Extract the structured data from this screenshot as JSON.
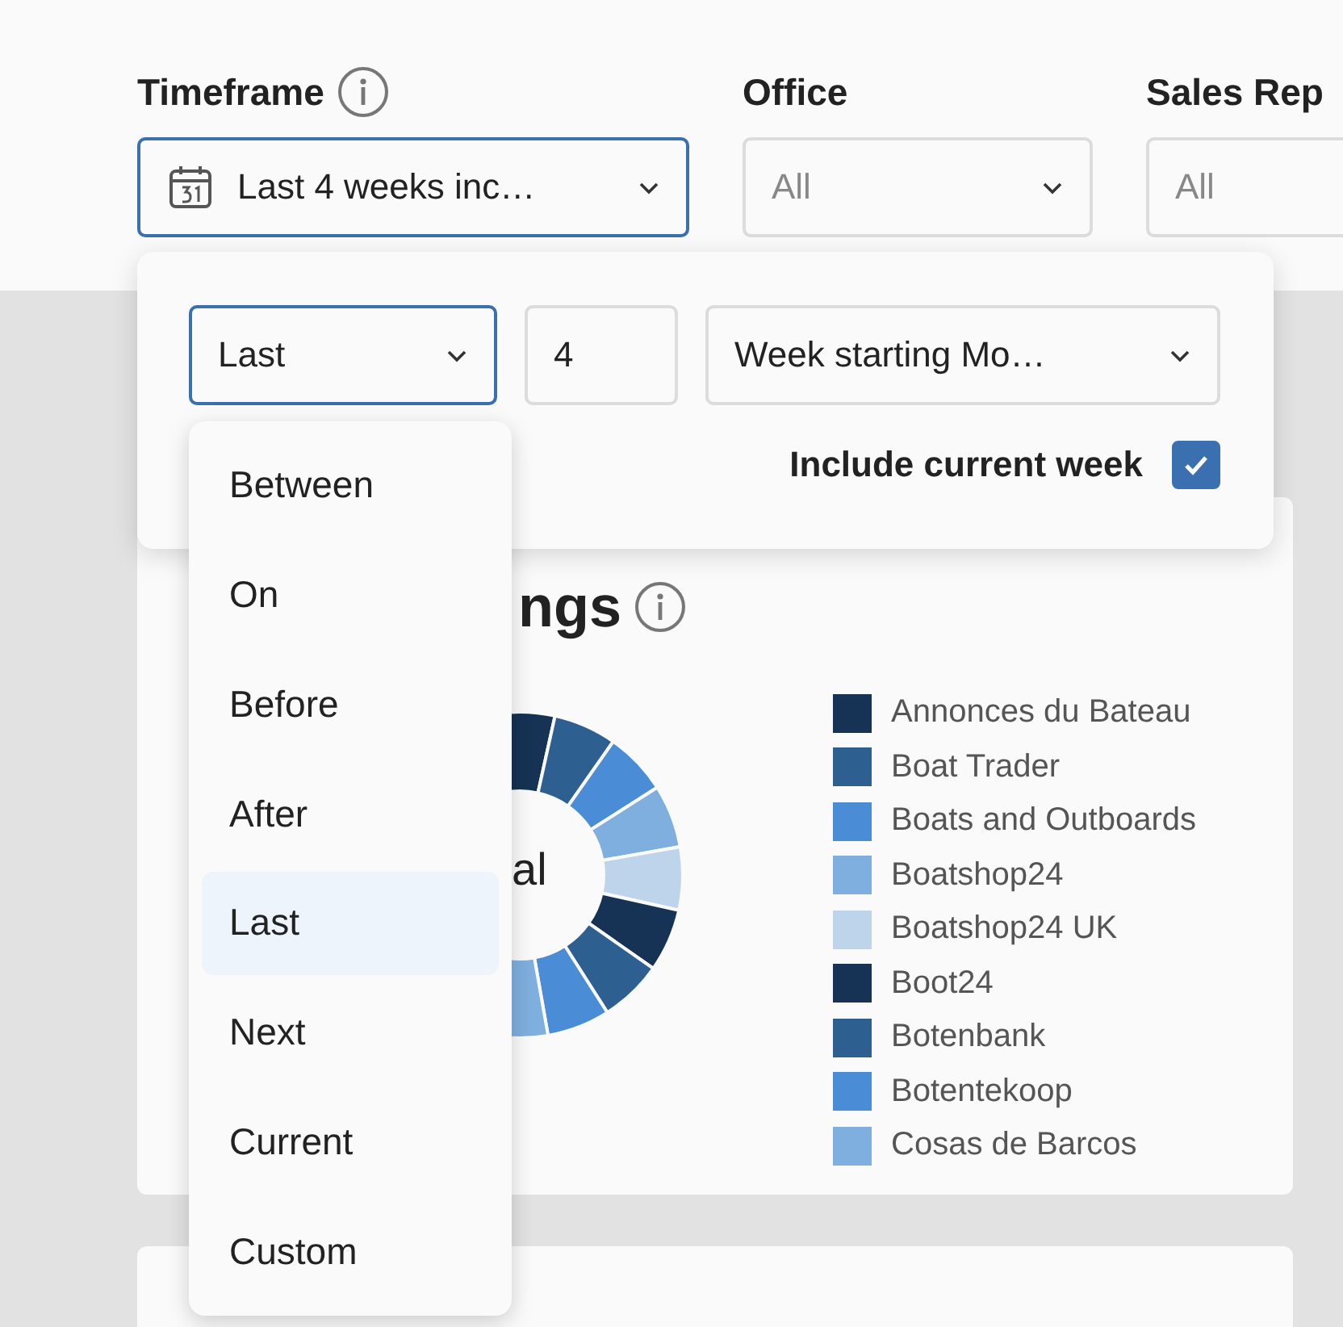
{
  "filters": [
    {
      "label": "Timeframe",
      "kind": "date",
      "info": true,
      "value": "Last 4 weeks inc…",
      "focused": true
    },
    {
      "label": "Office",
      "kind": "select",
      "info": false,
      "placeholder": "All",
      "focused": false
    },
    {
      "label": "Sales Rep",
      "kind": "select",
      "info": false,
      "placeholder": "All",
      "focused": false
    }
  ],
  "timeframe_popover": {
    "mode": "Last",
    "count": "4",
    "unit": "Week starting Mo…",
    "include_label": "Include current week",
    "include_checked": true
  },
  "mode_menu": [
    {
      "label": "Between",
      "selected": false
    },
    {
      "label": "On",
      "selected": false
    },
    {
      "label": "Before",
      "selected": false
    },
    {
      "label": "After",
      "selected": false
    },
    {
      "label": "Last",
      "selected": true
    },
    {
      "label": "Next",
      "selected": false
    },
    {
      "label": "Current",
      "selected": false
    },
    {
      "label": "Custom",
      "selected": false
    }
  ],
  "chart_card": {
    "title": "ngs",
    "center_label": "al",
    "legend": [
      {
        "label": "Annonces du Bateau",
        "color": "#163254"
      },
      {
        "label": "Boat Trader",
        "color": "#2d5f91"
      },
      {
        "label": "Boats and Outboards",
        "color": "#4a8cd6"
      },
      {
        "label": "Boatshop24",
        "color": "#7fafde"
      },
      {
        "label": "Boatshop24 UK",
        "color": "#bdd4ea"
      },
      {
        "label": "Boot24",
        "color": "#163254"
      },
      {
        "label": "Botenbank",
        "color": "#2d5f91"
      },
      {
        "label": "Botentekoop",
        "color": "#4a8cd6"
      },
      {
        "label": "Cosas de Barcos",
        "color": "#7fafde"
      }
    ]
  }
}
